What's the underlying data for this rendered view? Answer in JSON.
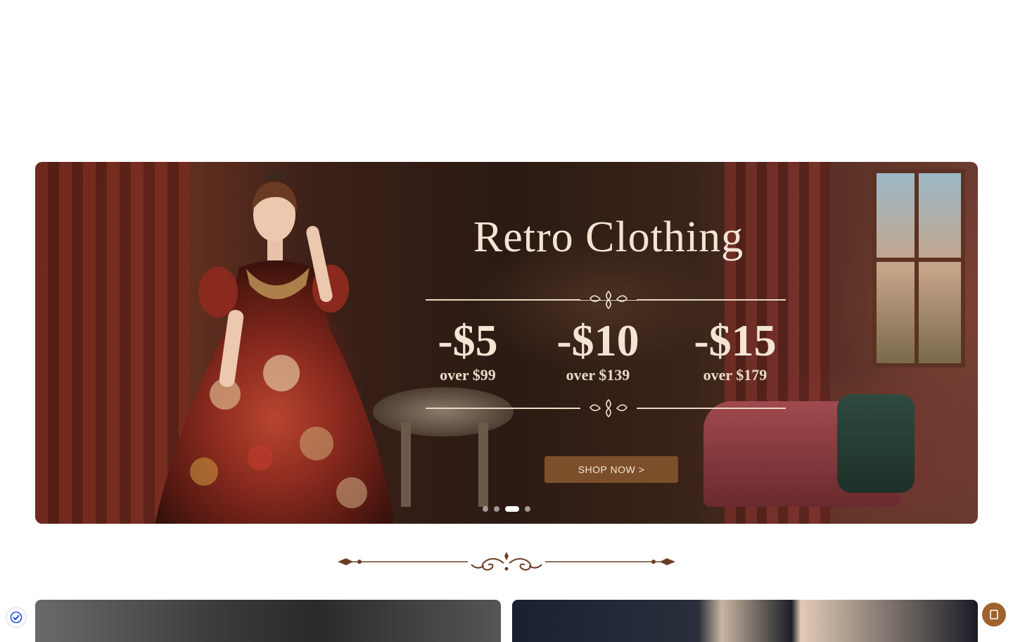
{
  "hero": {
    "title": "Retro Clothing",
    "offers": [
      {
        "amount": "-$5",
        "condition": "over $99"
      },
      {
        "amount": "-$10",
        "condition": "over $139"
      },
      {
        "amount": "-$15",
        "condition": "over $179"
      }
    ],
    "cta_label": "SHOP NOW >",
    "carousel": {
      "slide_count": 4,
      "active_index": 2
    }
  },
  "icons": {
    "privacy": "shield-check-icon",
    "chat": "chat-icon"
  },
  "colors": {
    "accent": "#7a4f2a",
    "hero_text": "#f3e4d4",
    "divider": "#6b3e24",
    "chat_button": "#a0622e"
  }
}
